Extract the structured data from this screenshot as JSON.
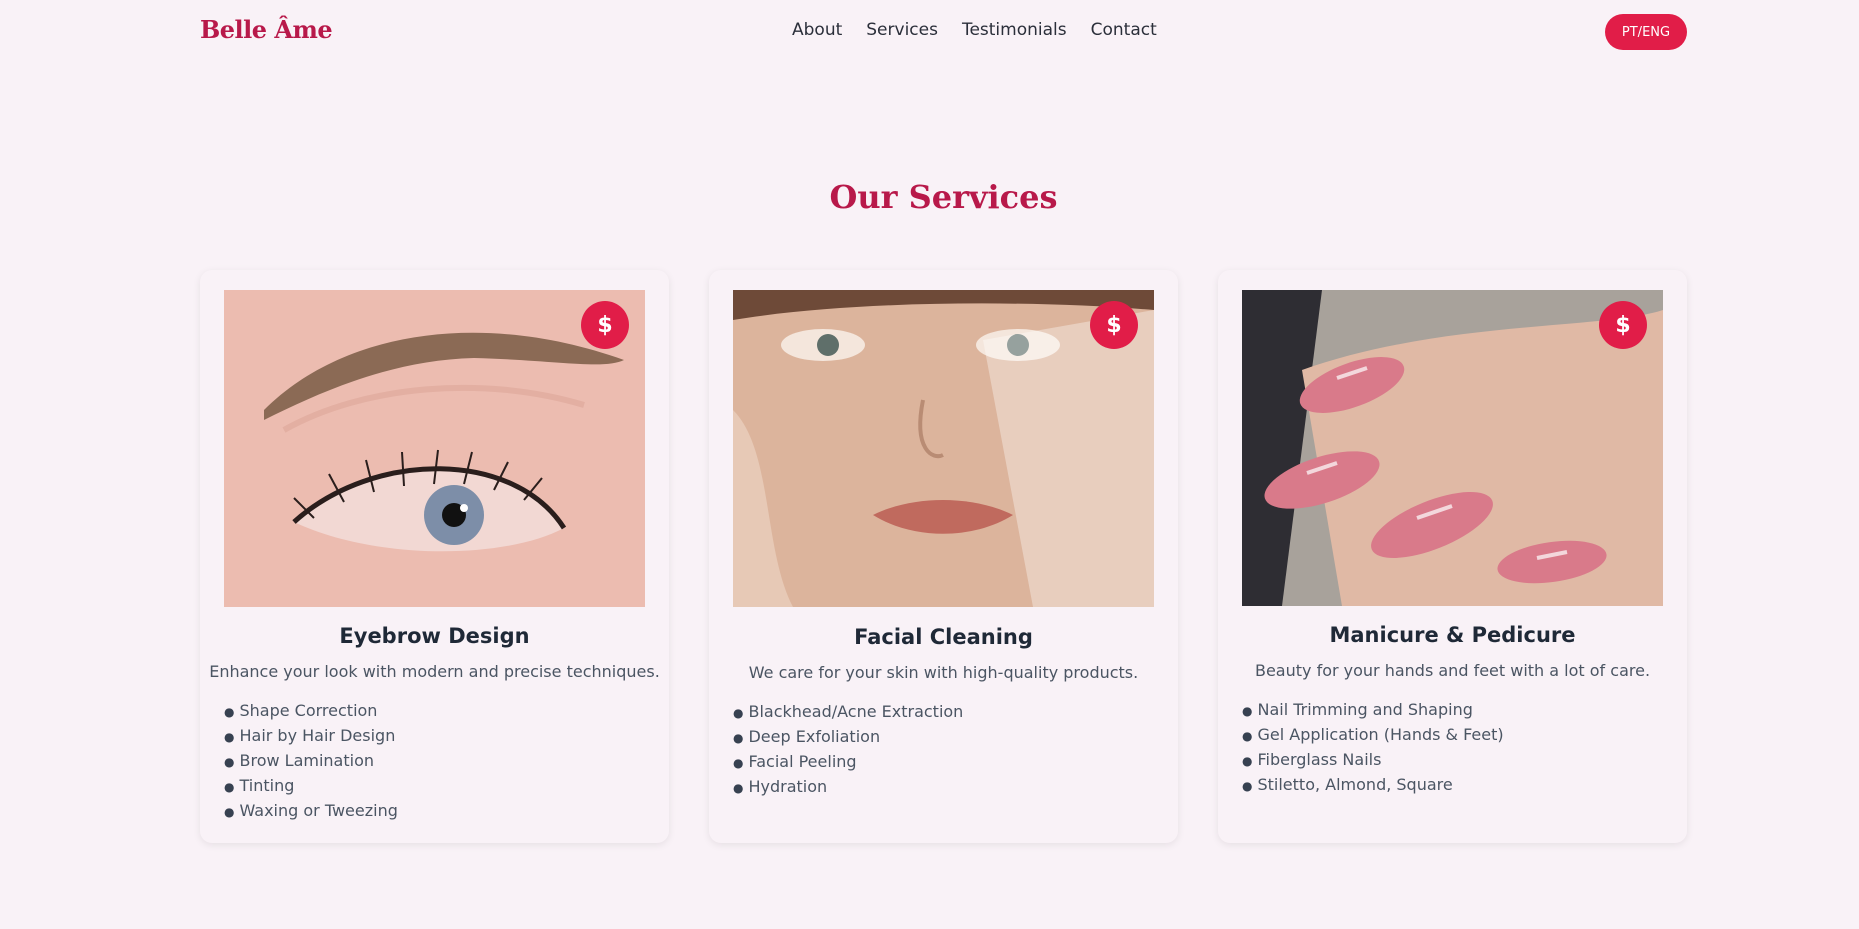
{
  "header": {
    "logo": "Belle Âme",
    "nav": [
      "About",
      "Services",
      "Testimonials",
      "Contact"
    ],
    "lang_button": "PT/ENG"
  },
  "services": {
    "title": "Our Services",
    "price_symbol": "$",
    "cards": [
      {
        "title": "Eyebrow Design",
        "description": "Enhance your look with modern and precise techniques.",
        "items": [
          "Shape Correction",
          "Hair by Hair Design",
          "Brow Lamination",
          "Tinting",
          "Waxing or Tweezing"
        ]
      },
      {
        "title": "Facial Cleaning",
        "description": "We care for your skin with high-quality products.",
        "items": [
          "Blackhead/Acne Extraction",
          "Deep Exfoliation",
          "Facial Peeling",
          "Hydration"
        ]
      },
      {
        "title": "Manicure & Pedicure",
        "description": "Beauty for your hands and feet with a lot of care.",
        "items": [
          "Nail Trimming and Shaping",
          "Gel Application (Hands & Feet)",
          "Fiberglass Nails",
          "Stiletto, Almond, Square"
        ]
      }
    ]
  },
  "colors": {
    "background": "#f9f2f7",
    "accent": "#e11d48",
    "brand": "#b8194a"
  }
}
